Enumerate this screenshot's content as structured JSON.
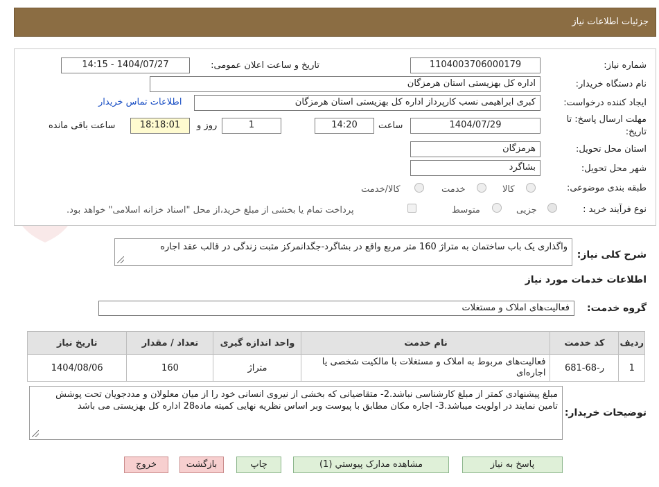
{
  "page": {
    "title": "جزئیات اطلاعات نیاز"
  },
  "fields": {
    "need_number_label": "شماره نیاز:",
    "need_number": "1104003706000179",
    "announce_label": "تاریخ و ساعت اعلان عمومی:",
    "announce_value": "1404/07/27 - 14:15",
    "buyer_label": "نام دستگاه خریدار:",
    "buyer": "اداره کل بهزیستی استان هرمزگان",
    "creator_label": "ایجاد کننده درخواست:",
    "creator": "کبری  ابراهیمی نسب کارپرداز اداره کل بهزیستی استان هرمزگان",
    "contact_link": "اطلاعات تماس خریدار",
    "deadline_label_1": "مهلت ارسال پاسخ: تا",
    "deadline_label_2": "تاریخ:",
    "deadline_date": "1404/07/29",
    "time_label": "ساعت",
    "deadline_time": "14:20",
    "days_value": "1",
    "days_label": "روز و",
    "remaining_time": "18:18:01",
    "remaining_label": "ساعت باقی مانده",
    "province_label": "استان محل تحویل:",
    "province": "هرمزگان",
    "city_label": "شهر محل تحویل:",
    "city": "بشاگرد",
    "category_label": "طبقه بندی موضوعی:",
    "category_options": [
      "کالا",
      "خدمت",
      "کالا/خدمت"
    ],
    "process_label": "نوع فرآیند خرید :",
    "process_options": [
      "جزیی",
      "متوسط"
    ],
    "payment_note": "پرداخت تمام یا بخشی از مبلغ خرید،از محل \"اسناد خزانه اسلامی\" خواهد بود."
  },
  "description": {
    "label": "شرح کلی نیاز:",
    "text": "واگذاری یک باب ساختمان به متراژ 160 متر مربع واقع در بشاگرد-جگدانمرکز مثبت زندگی در قالب عقد اجاره"
  },
  "services": {
    "section_title": "اطلاعات خدمات مورد نیاز",
    "group_label": "گروه خدمت:",
    "group_value": "فعالیت‌های  املاک و مستغلات",
    "columns": [
      "ردیف",
      "کد خدمت",
      "نام خدمت",
      "واحد اندازه گیری",
      "تعداد / مقدار",
      "تاریخ نیاز"
    ],
    "rows": [
      [
        "1",
        "ر-68-681",
        "فعالیت‌های مربوط به املاک و مستغلات با مالکیت شخصی یا اجاره‌ای",
        "متراژ",
        "160",
        "1404/08/06"
      ]
    ]
  },
  "buyer_notes": {
    "label": "توضیحات خریدار:",
    "text": "مبلغ پیشنهادی کمتر از مبلغ کارشناسی نباشد.2- متقاضیانی که بخشی از نیروی انسانی خود را از میان معلولان و مددجویان تحت پوشش تامین نمایند در اولویت میباشد.3-  اجاره مکان  مطابق با پیوست وبر اساس نظریه نهایی کمیته ماده28 اداره کل بهزیستی می باشد"
  },
  "buttons": {
    "reply": "پاسخ به نیاز",
    "attachments": "مشاهده مدارک پیوستي (1)",
    "print": "چاپ",
    "back": "بازگشت",
    "exit": "خروج"
  },
  "watermark": "AriaTender.neT",
  "colors": {
    "header_bg": "#8b6d43",
    "button_green": "#dff0d8",
    "button_pink": "#f7cfcf",
    "link": "#1a4fc4"
  }
}
